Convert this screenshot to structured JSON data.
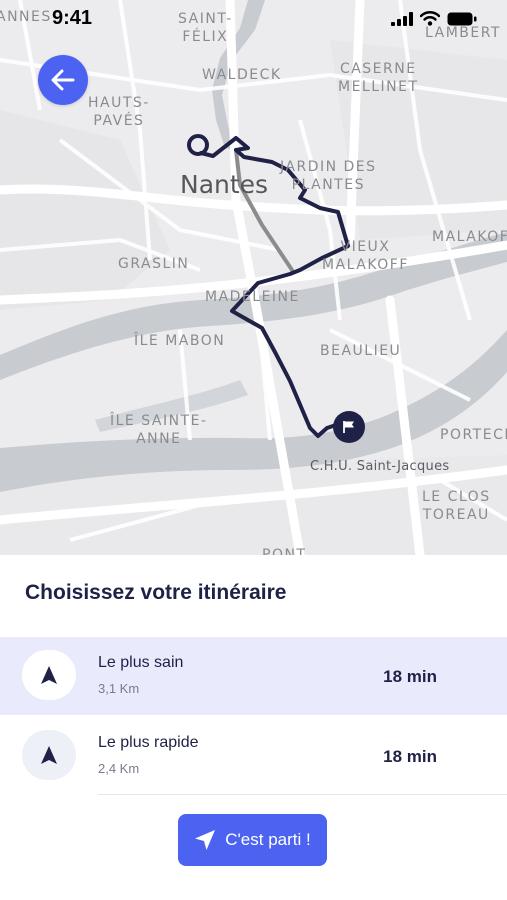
{
  "status_bar": {
    "time": "9:41",
    "icons": [
      "signal-icon",
      "wifi-icon",
      "battery-icon"
    ]
  },
  "map": {
    "labels": {
      "saint_felix": "SAINT-\nFÉLIX",
      "waldeck": "WALDECK",
      "caserne_mellinet": "CASERNE\nMELLINET",
      "hauts_paves": "HAUTS-\nPAVÉS",
      "lambert": "LAMBERT",
      "annes": "ANNES",
      "nantes": "Nantes",
      "jardin_des_plantes": "JARDIN DES\nPLANTES",
      "malakoff": "MALAKOFF",
      "vieux_malakoff": "VIEUX\nMALAKOFF",
      "graslin": "GRASLIN",
      "madeleine": "MADELEINE",
      "ile_mabon": "ÎLE MABON",
      "beaulieu": "BEAULIEU",
      "ile_sainte_anne": "ÎLE SAINTE-\nANNE",
      "porteche": "PORTECH",
      "chu": "C.H.U. Saint-Jacques",
      "le_clos_toreau": "LE CLOS\nTOREAU",
      "pont": "PONT"
    }
  },
  "sheet": {
    "title": "Choisissez votre itinéraire",
    "routes": [
      {
        "name": "Le plus sain",
        "distance": "3,1 Km",
        "duration": "18 min",
        "selected": true
      },
      {
        "name": "Le plus rapide",
        "distance": "2,4 Km",
        "duration": "18 min",
        "selected": false
      }
    ],
    "go_button": "C'est parti !"
  },
  "colors": {
    "accent": "#4b63f0",
    "route": "#1f2147",
    "alt_route": "#8c8c8c",
    "water": "#c8ccd0",
    "selected_row": "#e9ebfc"
  }
}
